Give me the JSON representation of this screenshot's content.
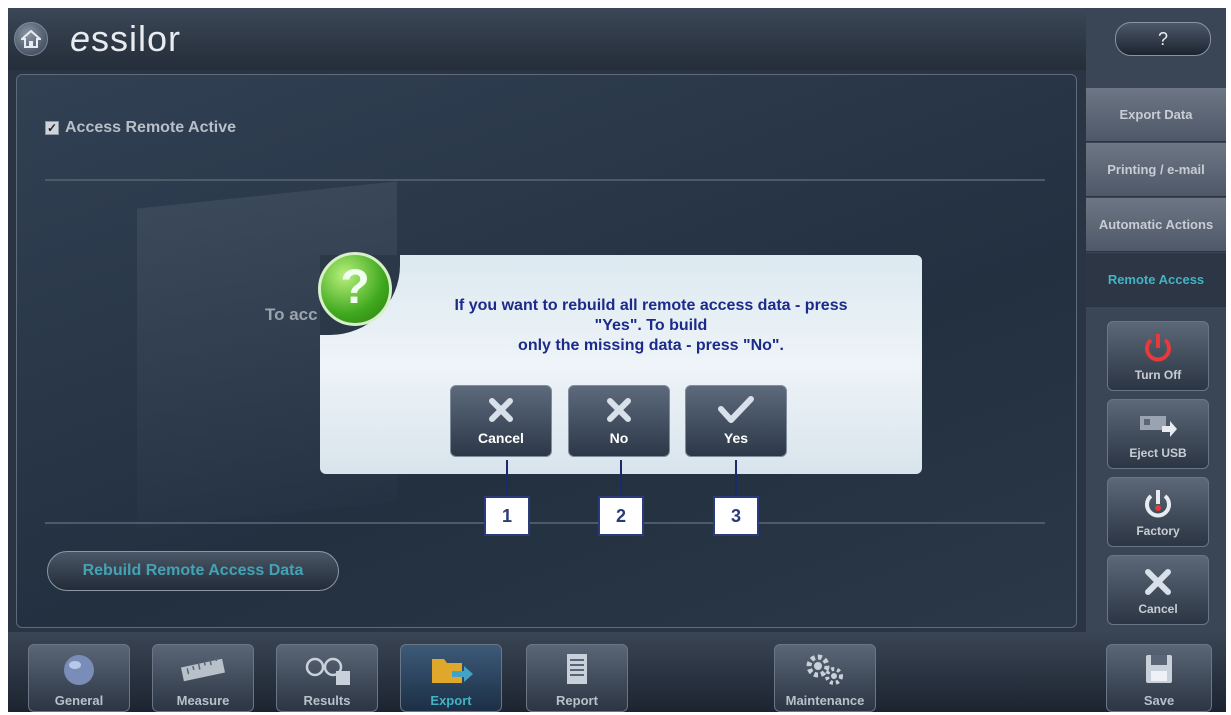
{
  "header": {
    "logo": "essilor",
    "help_label": "?"
  },
  "right_tabs": [
    "Export Data",
    "Printing / e-mail",
    "Automatic Actions",
    "Remote Access"
  ],
  "right_buttons": [
    "Turn Off",
    "Eject USB",
    "Factory",
    "Cancel"
  ],
  "panel": {
    "checkbox_label": "Access Remote Active",
    "hint": "To acc",
    "rebuild_label": "Rebuild Remote  Access Data"
  },
  "dialog": {
    "line1": "If you want to rebuild all remote access data - press",
    "line2": "\"Yes\". To build",
    "line3": "only the missing data - press \"No\".",
    "cancel_label": "Cancel",
    "no_label": "No",
    "yes_label": "Yes"
  },
  "callouts": [
    "1",
    "2",
    "3"
  ],
  "bottom_nav": [
    "General",
    "Measure",
    "Results",
    "Export",
    "Report",
    "Maintenance",
    "Save"
  ],
  "colors": {
    "accent": "#43b3c4",
    "dialog_text": "#1c2a8a",
    "question_icon": "#3fa81e"
  }
}
